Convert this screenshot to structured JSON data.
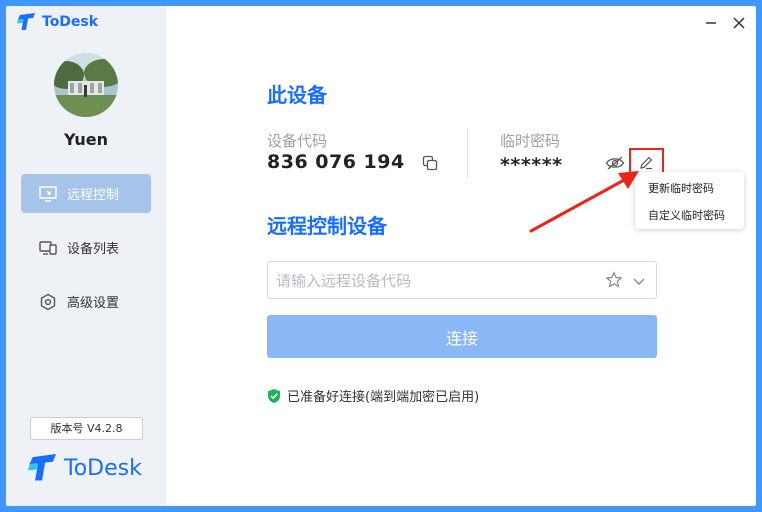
{
  "app": {
    "title": "ToDesk",
    "brand": "ToDesk"
  },
  "user": {
    "name": "Yuen"
  },
  "sidebar": {
    "items": [
      {
        "label": "远程控制",
        "icon": "remote-screen-icon",
        "active": true
      },
      {
        "label": "设备列表",
        "icon": "device-list-icon",
        "active": false
      },
      {
        "label": "高级设置",
        "icon": "settings-hexagon-icon",
        "active": false
      }
    ],
    "version": "版本号 V4.2.8"
  },
  "device": {
    "title": "此设备",
    "code_label": "设备代码",
    "code_value": "836 076 194",
    "password_label": "临时密码",
    "password_value": "******"
  },
  "popup": {
    "items": [
      "更新临时密码",
      "自定义临时密码"
    ]
  },
  "remote": {
    "title": "远程控制设备",
    "input_placeholder": "请输入远程设备代码",
    "input_value": "",
    "connect_label": "连接"
  },
  "status": {
    "text": "已准备好连接(端到端加密已启用)",
    "color": "#19b35a"
  },
  "colors": {
    "accent": "#1a6dff",
    "frame": "#3f97ff",
    "highlight": "#e8261a"
  }
}
